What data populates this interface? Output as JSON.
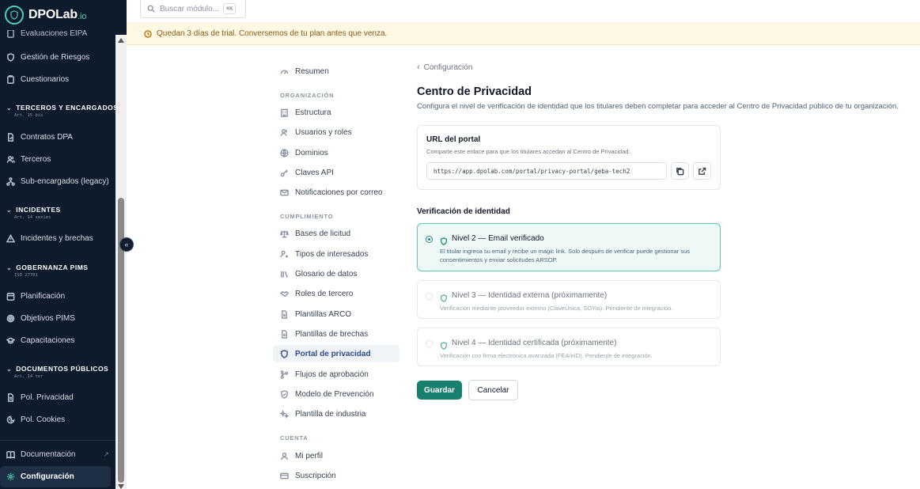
{
  "brand": {
    "name": "DPOLab",
    "suffix": ".io"
  },
  "sidebar": {
    "clipped_item": "Evaluaciones EIPA",
    "items_top": [
      {
        "label": "Gestión de Riesgos",
        "icon": "shield-icon"
      },
      {
        "label": "Cuestionarios",
        "icon": "clipboard-icon"
      }
    ],
    "sections": [
      {
        "title": "TERCEROS Y ENCARGADOS",
        "sub": "Art. 15 bis",
        "items": [
          {
            "label": "Contratos DPA",
            "icon": "contract-icon"
          },
          {
            "label": "Terceros",
            "icon": "users-icon"
          },
          {
            "label": "Sub-encargados (legacy)",
            "icon": "network-icon"
          }
        ]
      },
      {
        "title": "INCIDENTES",
        "sub": "Art. 14 sexies",
        "items": [
          {
            "label": "Incidentes y brechas",
            "icon": "alert-triangle-icon"
          }
        ]
      },
      {
        "title": "GOBERNANZA PIMS",
        "sub": "ISO 27701",
        "items": [
          {
            "label": "Planificación",
            "icon": "calendar-icon"
          },
          {
            "label": "Objetivos PIMS",
            "icon": "target-icon"
          },
          {
            "label": "Capacitaciones",
            "icon": "graduation-cap-icon"
          }
        ]
      },
      {
        "title": "DOCUMENTOS PÚBLICOS",
        "sub": "Art. 14 ter",
        "items": [
          {
            "label": "Pol. Privacidad",
            "icon": "document-icon"
          },
          {
            "label": "Pol. Cookies",
            "icon": "cookie-icon"
          }
        ]
      }
    ],
    "bottom": [
      {
        "label": "Documentación",
        "icon": "book-icon"
      },
      {
        "label": "Configuración",
        "icon": "gear-icon"
      }
    ],
    "collapse_label": "«"
  },
  "topbar": {
    "search_placeholder": "Buscar módulo...",
    "search_shortcut": "⌘K"
  },
  "trial_banner": "Quedan 3 días de trial. Conversemos de tu plan antes que venza.",
  "settings_nav": {
    "summary": "Resumen",
    "groups": [
      {
        "heading": "ORGANIZACIÓN",
        "items": [
          "Estructura",
          "Usuarios y roles",
          "Dominios",
          "Claves API",
          "Notificaciones por correo"
        ]
      },
      {
        "heading": "CUMPLIMIENTO",
        "items": [
          "Bases de licitud",
          "Tipos de interesados",
          "Glosario de datos",
          "Roles de tercero",
          "Plantillas ARCO",
          "Plantillas de brechas",
          "Portal de privacidad",
          "Flujos de aprobación",
          "Modelo de Prevención",
          "Plantilla de industria"
        ]
      },
      {
        "heading": "CUENTA",
        "items": [
          "Mi perfil",
          "Suscripción"
        ]
      }
    ],
    "active": "Portal de privacidad"
  },
  "main": {
    "breadcrumb": "Configuración",
    "title": "Centro de Privacidad",
    "description": "Configura el nivel de verificación de identidad que los titulares deben completar para acceder al Centro de Privacidad público de tu organización.",
    "portal_card": {
      "title": "URL del portal",
      "description": "Comparte este enlace para que los titulares accedan al Centro de Privacidad.",
      "url": "https://app.dpolab.com/portal/privacy-portal/geba-tech2"
    },
    "verification_heading": "Verificación de identidad",
    "levels": [
      {
        "title": "Nivel 2 — Email verificado",
        "description": "El titular ingresa su email y recibe un magic link. Solo después de verificar puede gestionar sus consentimientos y enviar solicitudes ARSOP.",
        "selected": true,
        "disabled": false
      },
      {
        "title": "Nivel 3 — Identidad externa (próximamente)",
        "description": "Verificación mediante proveedor externo (ClaveÚnica, SOYio). Pendiente de integración.",
        "selected": false,
        "disabled": true
      },
      {
        "title": "Nivel 4 — Identidad certificada (próximamente)",
        "description": "Verificación con firma electrónica avanzada (FEA/eID). Pendiente de integración.",
        "selected": false,
        "disabled": true
      }
    ],
    "save_label": "Guardar",
    "cancel_label": "Cancelar"
  },
  "colors": {
    "sidebar_bg": "#0e1b2c",
    "accent": "#17806e",
    "selected_bg": "#effaf7",
    "banner_bg": "#fdf7e4"
  }
}
